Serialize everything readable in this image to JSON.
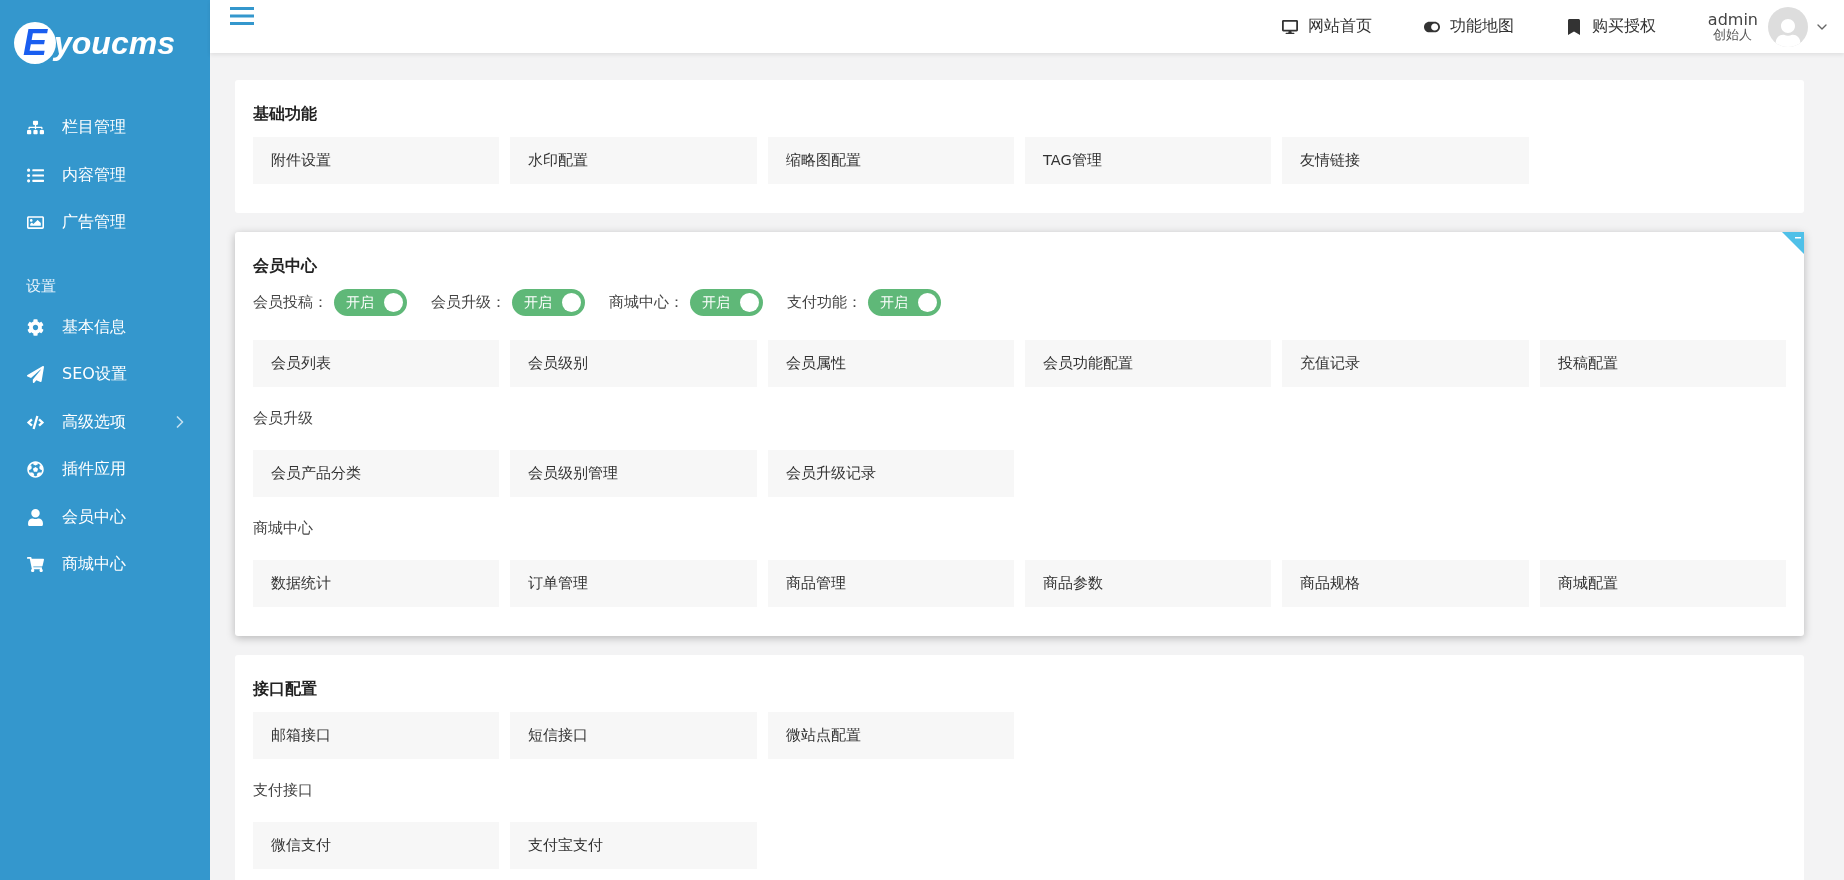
{
  "logo": {
    "letter": "E",
    "text": "youcms"
  },
  "sidebar": {
    "main_items": [
      {
        "label": "栏目管理"
      },
      {
        "label": "内容管理"
      },
      {
        "label": "广告管理"
      }
    ],
    "section_title": "设置",
    "settings_items": [
      {
        "label": "基本信息",
        "has_submenu": false
      },
      {
        "label": "SEO设置",
        "has_submenu": false
      },
      {
        "label": "高级选项",
        "has_submenu": true
      },
      {
        "label": "插件应用",
        "has_submenu": false
      },
      {
        "label": "会员中心",
        "has_submenu": false
      },
      {
        "label": "商城中心",
        "has_submenu": false
      }
    ]
  },
  "topbar": {
    "links": [
      {
        "label": "网站首页"
      },
      {
        "label": "功能地图"
      },
      {
        "label": "购买授权"
      }
    ],
    "user": {
      "name": "admin",
      "role": "创始人"
    }
  },
  "cards": [
    {
      "title": "基础功能",
      "highlighted": false,
      "groups": [
        {
          "items": [
            "附件设置",
            "水印配置",
            "缩略图配置",
            "TAG管理",
            "友情链接"
          ]
        }
      ]
    },
    {
      "title": "会员中心",
      "highlighted": true,
      "toggles": [
        {
          "label": "会员投稿：",
          "text": "开启",
          "on": true
        },
        {
          "label": "会员升级：",
          "text": "开启",
          "on": true
        },
        {
          "label": "商城中心：",
          "text": "开启",
          "on": true
        },
        {
          "label": "支付功能：",
          "text": "开启",
          "on": true
        }
      ],
      "groups": [
        {
          "items": [
            "会员列表",
            "会员级别",
            "会员属性",
            "会员功能配置",
            "充值记录",
            "投稿配置"
          ]
        },
        {
          "heading": "会员升级",
          "items": [
            "会员产品分类",
            "会员级别管理",
            "会员升级记录"
          ]
        },
        {
          "heading": "商城中心",
          "items": [
            "数据统计",
            "订单管理",
            "商品管理",
            "商品参数",
            "商品规格",
            "商城配置"
          ]
        }
      ]
    },
    {
      "title": "接口配置",
      "highlighted": false,
      "groups": [
        {
          "items": [
            "邮箱接口",
            "短信接口",
            "微站点配置"
          ]
        },
        {
          "heading": "支付接口",
          "items": [
            "微信支付",
            "支付宝支付"
          ]
        }
      ]
    }
  ]
}
